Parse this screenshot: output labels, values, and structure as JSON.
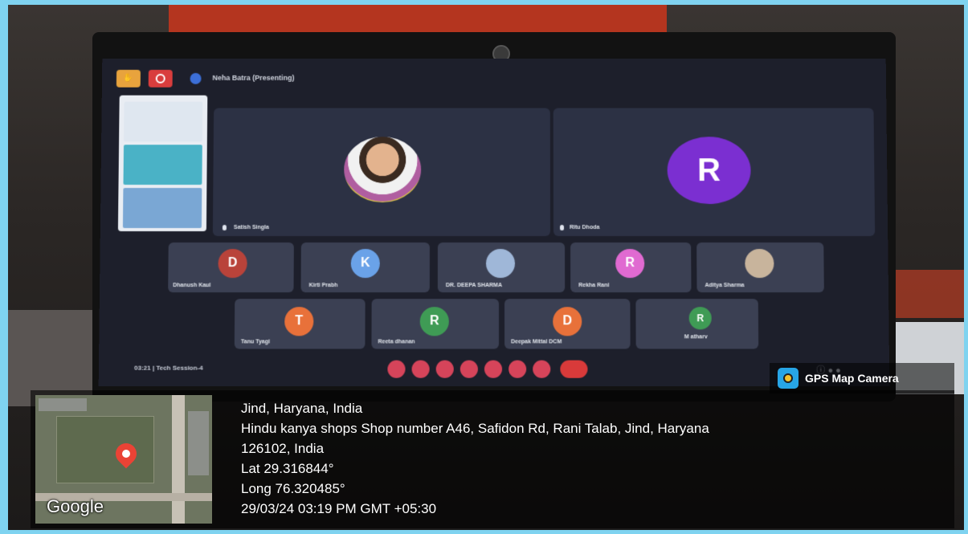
{
  "meeting": {
    "presenter_text": "Neha Batra (Presenting)",
    "tiles_large": [
      {
        "name": "Satish Singla"
      },
      {
        "name": "Ritu Dhoda",
        "initial": "R"
      }
    ],
    "tiles_row1": [
      {
        "name": "Dhanush Kaul",
        "initial": "D",
        "color": "#b9433a"
      },
      {
        "name": "Kirti Prabh",
        "initial": "K",
        "color": "#6aa2e8"
      },
      {
        "name": "DR. DEEPA SHARMA",
        "initial": "",
        "color": "#9fb7d8"
      },
      {
        "name": "Rekha Rani",
        "initial": "R",
        "color": "#e06ad1"
      },
      {
        "name": "Aditya Sharma",
        "initial": "",
        "color": "#c8b49c"
      }
    ],
    "tiles_row2": [
      {
        "name": "Tanu Tyagi",
        "initial": "T",
        "color": "#e8713a"
      },
      {
        "name": "Reeta dhanan",
        "initial": "R",
        "color": "#3f9b55"
      },
      {
        "name": "Deepak Mittal DCM",
        "initial": "D",
        "color": "#e8713a"
      },
      {
        "name": "M atharv",
        "initial": "R",
        "color": "#3f9b55"
      }
    ],
    "clock_text": "03:21  |  Tech Session-4"
  },
  "gps_camera": {
    "title": "GPS Map Camera",
    "location_title": "Jind, Haryana, India",
    "address_line1": "Hindu kanya shops Shop number A46, Safidon Rd, Rani Talab, Jind, Haryana",
    "address_line2": "126102, India",
    "lat": "Lat 29.316844°",
    "long": "Long 76.320485°",
    "datetime": "29/03/24 03:19 PM GMT +05:30",
    "map_brand": "Google"
  }
}
